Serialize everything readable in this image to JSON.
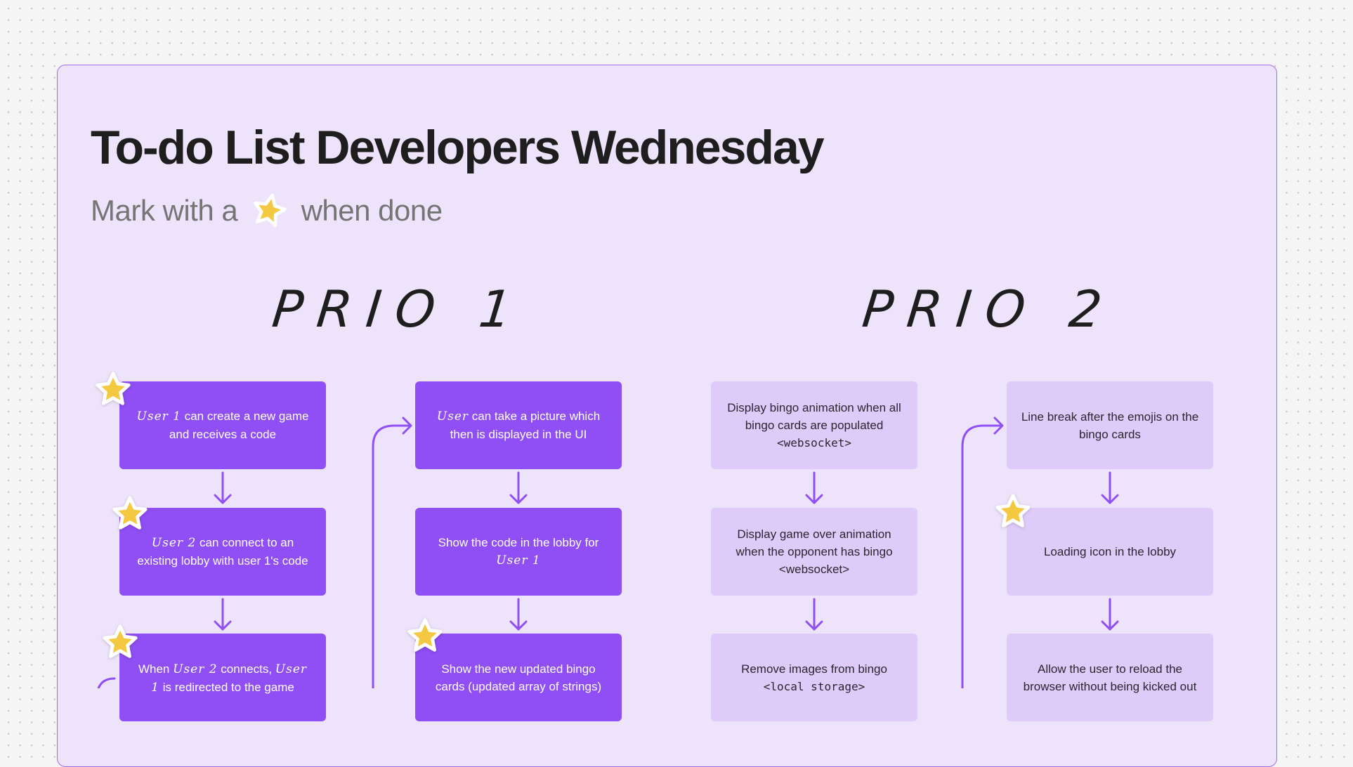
{
  "board": {
    "title": "To-do List Developers Wednesday",
    "subtitle_before": "Mark with a",
    "subtitle_after": "when done",
    "subtitle_icon": "star-icon"
  },
  "colors": {
    "accent": "#8f4ff4",
    "frame_bg": "#ede3fb",
    "light_card": "#dfcbf9",
    "star": "#f5c842"
  },
  "prio1": {
    "heading": "PRIO 1",
    "columns": [
      {
        "cards": [
          {
            "hand": "User 1",
            "text": " can create a new game and receives a code",
            "done": true
          },
          {
            "hand": "User 2",
            "text": " can connect to an existing lobby with user 1's code",
            "done": true
          },
          {
            "pre": "When ",
            "hand": "User 2",
            "text": " connects, ",
            "hand2": "User 1",
            "post": " is redirected to the game",
            "done": true
          }
        ]
      },
      {
        "cards": [
          {
            "hand": "User",
            "text": " can take a picture which then is displayed in the UI",
            "done": false
          },
          {
            "pre": "Show the code in the lobby for ",
            "hand": "User 1",
            "done": false
          },
          {
            "pre": "Show the new updated bingo cards (updated array of strings)",
            "done": true
          }
        ]
      }
    ]
  },
  "prio2": {
    "heading": "PRIO 2",
    "columns": [
      {
        "cards": [
          {
            "pre": "Display bingo animation when all bingo cards are populated",
            "mono": "<websocket>",
            "done": false
          },
          {
            "pre": "Display game over animation when the opponent has bingo",
            "tag": "<websocket>",
            "done": false
          },
          {
            "pre": "Remove images from bingo",
            "mono": "<local storage>",
            "done": false
          }
        ]
      },
      {
        "cards": [
          {
            "pre": "Line break after the emojis on the bingo cards",
            "done": false
          },
          {
            "pre": "Loading icon in the lobby",
            "done": true
          },
          {
            "pre": "Allow the user to reload the browser without being kicked out",
            "done": false
          }
        ]
      }
    ]
  }
}
